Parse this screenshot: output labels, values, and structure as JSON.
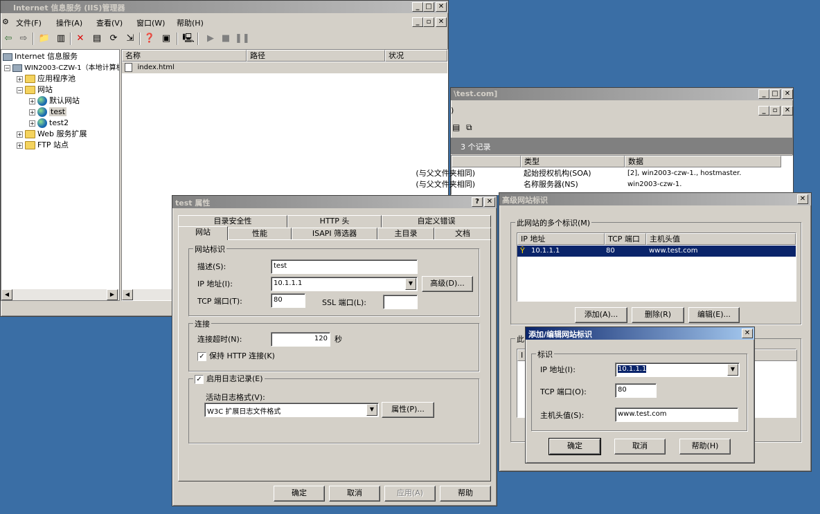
{
  "iis": {
    "title": "Internet 信息服务 (IIS)管理器",
    "menu": [
      "文件(F)",
      "操作(A)",
      "查看(V)",
      "窗口(W)",
      "帮助(H)"
    ],
    "tree": [
      {
        "label": "Internet 信息服务"
      },
      {
        "label": "WIN2003-CZW-1（本地计算机）"
      },
      {
        "label": "应用程序池"
      },
      {
        "label": "网站"
      },
      {
        "label": "默认网站"
      },
      {
        "label": "test"
      },
      {
        "label": "test2"
      },
      {
        "label": "Web 服务扩展"
      },
      {
        "label": "FTP 站点"
      }
    ],
    "columns": [
      "名称",
      "路径",
      "状况"
    ],
    "files": [
      "index.html"
    ]
  },
  "dns": {
    "title": "\\test.com]",
    "record_count": "3 个记录",
    "columns": [
      "类型",
      "数据"
    ],
    "rows": [
      {
        "name": "(与父文件夹相同)",
        "type": "起始授权机构(SOA)",
        "data": "[2], win2003-czw-1., hostmaster."
      },
      {
        "name": "(与父文件夹相同)",
        "type": "名称服务器(NS)",
        "data": "win2003-czw-1."
      }
    ]
  },
  "props": {
    "title": "test 属性",
    "tabs_back": [
      "目录安全性",
      "HTTP 头",
      "自定义错误"
    ],
    "tabs_front": [
      "网站",
      "性能",
      "ISAPI 筛选器",
      "主目录",
      "文档"
    ],
    "group_identity": "网站标识",
    "desc_label": "描述(S):",
    "desc_value": "test",
    "ip_label": "IP 地址(I):",
    "ip_value": "10.1.1.1",
    "advanced_btn": "高级(D)...",
    "tcp_label": "TCP 端口(T):",
    "tcp_value": "80",
    "ssl_label": "SSL 端口(L):",
    "ssl_value": "",
    "group_conn": "连接",
    "timeout_label": "连接超时(N):",
    "timeout_value": "120",
    "timeout_unit": "秒",
    "keepalive_label": "保持 HTTP 连接(K)",
    "logging_label": "启用日志记录(E)",
    "logformat_label": "活动日志格式(V):",
    "logformat_value": "W3C 扩展日志文件格式",
    "logprops_btn": "属性(P)...",
    "ok": "确定",
    "cancel": "取消",
    "apply": "应用(A)",
    "help": "帮助"
  },
  "advanced": {
    "title": "高级网站标识",
    "group_multi": "此网站的多个标识(M)",
    "columns": [
      "IP 地址",
      "TCP 端口",
      "主机头值"
    ],
    "rows": [
      {
        "ip": "10.1.1.1",
        "port": "80",
        "host": "www.test.com"
      }
    ],
    "add": "添加(A)...",
    "remove": "删除(R)",
    "edit": "编辑(E)...",
    "group_ssl_partial": "此",
    "ssl_col_partial": "I"
  },
  "edit": {
    "title": "添加/编辑网站标识",
    "group": "标识",
    "ip_label": "IP 地址(I):",
    "ip_value": "10.1.1.1",
    "tcp_label": "TCP 端口(O):",
    "tcp_value": "80",
    "host_label": "主机头值(S):",
    "host_value": "www.test.com",
    "ok": "确定",
    "cancel": "取消",
    "help": "帮助(H)"
  },
  "colors": {
    "titlebar_active": "#7a96df",
    "titlebar_inactive": "#808080",
    "desktop": "#3a6ea5",
    "selection": "#0a246a"
  }
}
